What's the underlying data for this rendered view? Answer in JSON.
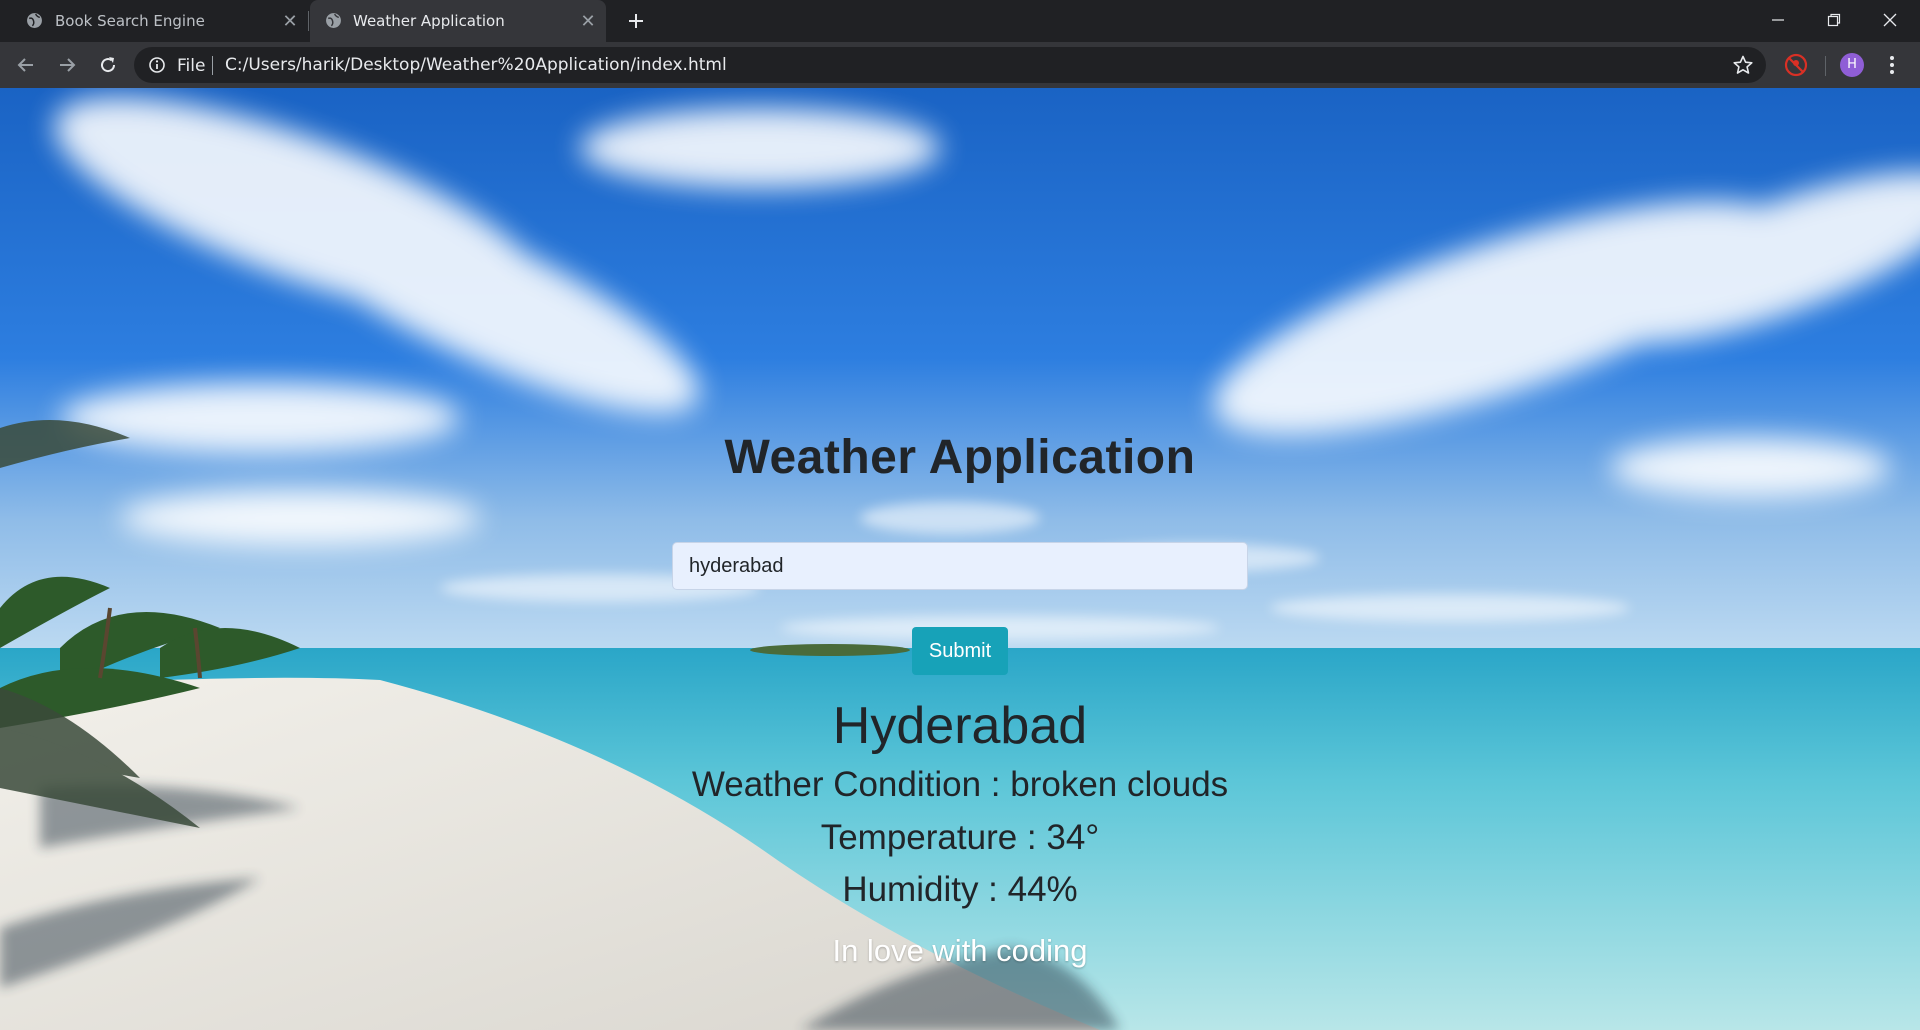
{
  "browser": {
    "tabs": [
      {
        "title": "Book Search Engine",
        "active": false
      },
      {
        "title": "Weather Application",
        "active": true
      }
    ],
    "address": {
      "scheme_label": "File",
      "url": "C:/Users/harik/Desktop/Weather%20Application/index.html"
    },
    "profile_initial": "H"
  },
  "page": {
    "title": "Weather Application",
    "search": {
      "value": "hyderabad",
      "placeholder": ""
    },
    "submit_label": "Submit",
    "result": {
      "city": "Hyderabad",
      "condition": "Weather Condition : broken clouds",
      "temperature": "Temperature : 34°",
      "humidity": "Humidity : 44%"
    },
    "footer": "In love with coding"
  },
  "colors": {
    "accent": "#17a2b8",
    "tab_bg": "#202124",
    "toolbar_bg": "#35363a",
    "text_dark": "#212529",
    "avatar": "#8f5ed6"
  }
}
